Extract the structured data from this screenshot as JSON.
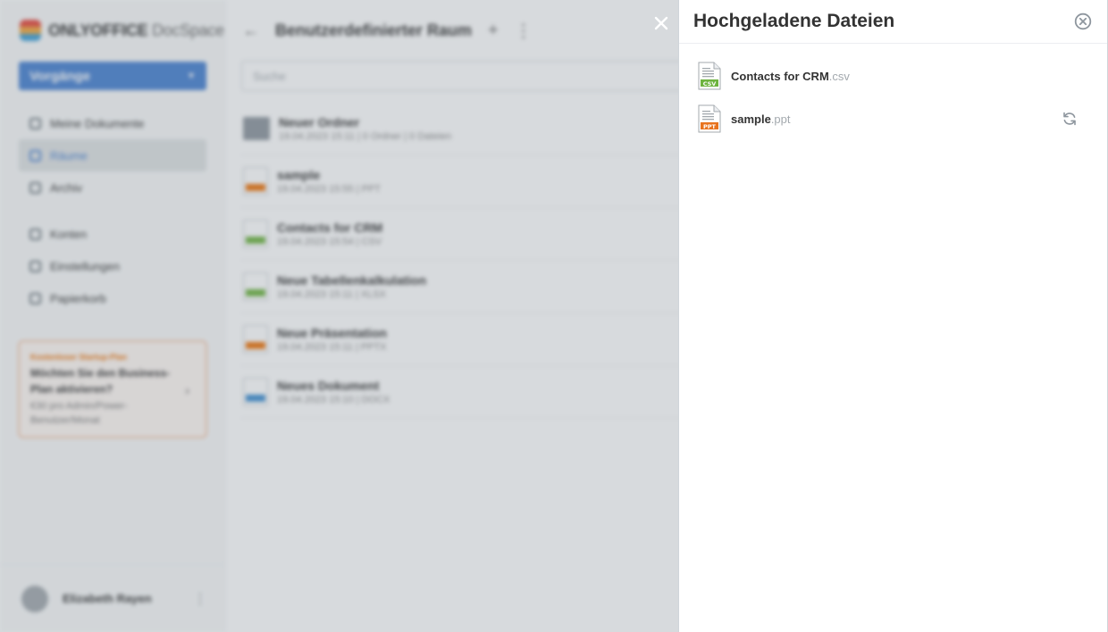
{
  "app": {
    "logo_brand": "ONLYOFFICE",
    "logo_product": "DocSpace",
    "actions_button": "Vorgänge",
    "nav": [
      {
        "label": "Meine Dokumente",
        "active": false
      },
      {
        "label": "Räume",
        "active": true
      },
      {
        "label": "Archiv",
        "active": false
      },
      {
        "label": "Konten",
        "active": false
      },
      {
        "label": "Einstellungen",
        "active": false
      },
      {
        "label": "Papierkorb",
        "active": false
      }
    ],
    "promo": {
      "tag": "Kostenloser Startup-Plan",
      "title": "Möchten Sie den Business-Plan aktivieren?",
      "subtitle": "€30 pro Admin/Power-Benutzer/Monat"
    },
    "user_name": "Elizabeth Rayen",
    "room_title": "Benutzerdefinierter Raum",
    "search_placeholder": "Suche",
    "files": [
      {
        "name": "Neuer Ordner",
        "meta": "19.04.2023 15:11 | 0 Ordner | 0 Dateien",
        "kind": "folder",
        "color": "#8e969e"
      },
      {
        "name": "sample",
        "meta": "19.04.2023 15:55 | PPT",
        "kind": "file",
        "color": "#ed7309"
      },
      {
        "name": "Contacts for CRM",
        "meta": "19.04.2023 15:54 | CSV",
        "kind": "file",
        "color": "#6db33f"
      },
      {
        "name": "Neue Tabellenkalkulation",
        "meta": "19.04.2023 15:11 | XLSX",
        "kind": "file",
        "color": "#6db33f"
      },
      {
        "name": "Neue Präsentation",
        "meta": "19.04.2023 15:11 | PPTX",
        "kind": "file",
        "color": "#ed7309"
      },
      {
        "name": "Neues Dokument",
        "meta": "19.04.2023 15:10 | DOCX",
        "kind": "file",
        "color": "#3e8ed0"
      }
    ]
  },
  "panel": {
    "title": "Hochgeladene Dateien",
    "uploads": [
      {
        "name": "Contacts for CRM",
        "ext": ".csv",
        "badge": "CSV",
        "color": "#6db33f",
        "retry": false
      },
      {
        "name": "sample",
        "ext": ".ppt",
        "badge": "PPT",
        "color": "#e8731e",
        "retry": true
      }
    ]
  },
  "icons": {
    "close_panel": "close-icon",
    "clear_list": "circle-close-icon",
    "retry": "refresh-icon"
  }
}
